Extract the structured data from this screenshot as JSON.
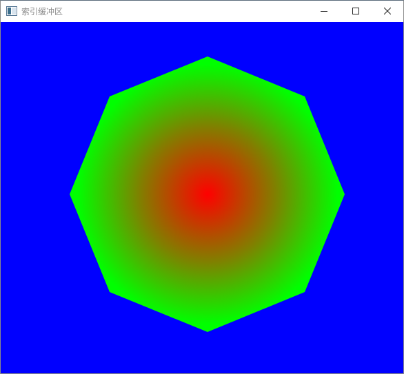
{
  "window": {
    "title": "索引缓冲区",
    "icon": "app-window-icon",
    "controls": [
      "minimize-icon",
      "maximize-icon",
      "close-icon"
    ]
  },
  "render": {
    "background_color": "#0000ff",
    "shape": "octagon",
    "vertex_count": 8,
    "center_color": "#ff0000",
    "edge_color": "#00ff00"
  }
}
